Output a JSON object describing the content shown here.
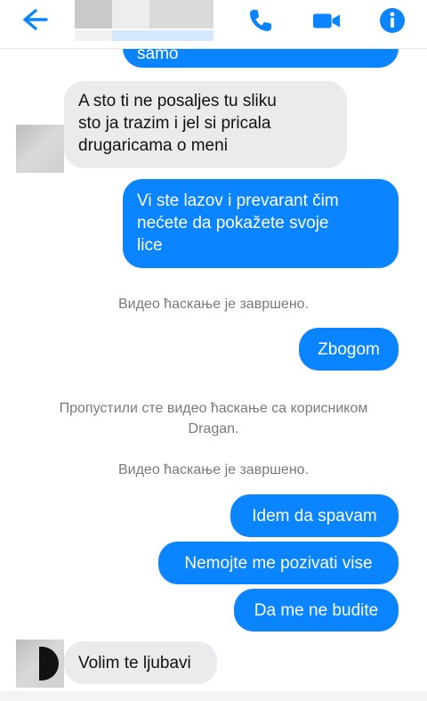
{
  "header": {
    "back_icon": "arrow-left-icon",
    "call_icon": "phone-icon",
    "video_icon": "video-camera-icon",
    "info_icon": "info-icon",
    "accent_color": "#0a84ff"
  },
  "messages": {
    "partial_top": "samo",
    "m1": [
      "A sto ti ne posaljes tu sliku",
      "sto ja trazim i jel si pricala",
      "drugaricama o  meni"
    ],
    "m2": [
      "Vi ste lazov i prevarant čim",
      "nećete da pokažete svoje",
      "lice"
    ],
    "sys1": "Видео ћаскање је завршено.",
    "m3": "Zbogom",
    "sys2": [
      "Пропустили сте видео ћаскање са корисником",
      "Dragan."
    ],
    "sys3": "Видео ћаскање је завршено.",
    "m4": "Idem da spavam",
    "m5": "Nemojte me pozivati vise",
    "m6": "Da me ne budite",
    "m7": "Volim te ljubavi"
  },
  "colors": {
    "outgoing_bubble": "#0a84ff",
    "incoming_bubble": "#ebebed",
    "system_text": "#7a7a7a"
  }
}
